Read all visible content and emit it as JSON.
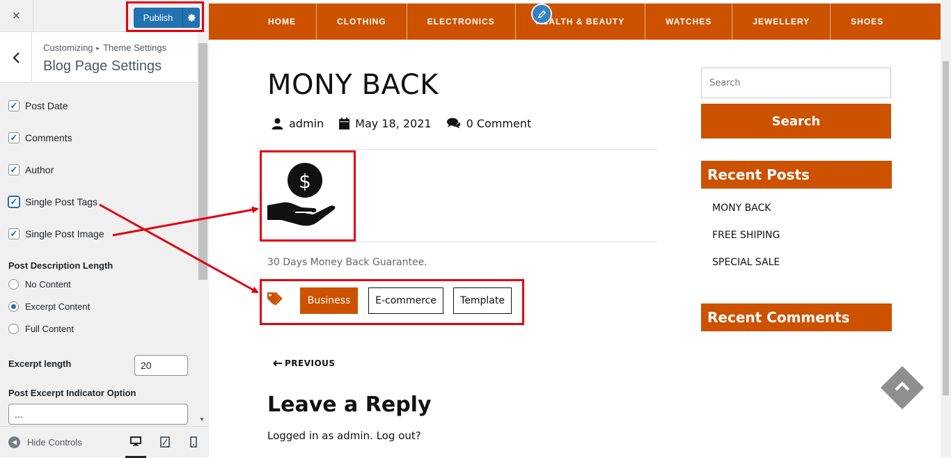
{
  "customizer": {
    "close_icon": "×",
    "publish_label": "Publish",
    "publish_settings_icon": "gear-icon",
    "breadcrumb_root": "Customizing",
    "breadcrumb_separator": "▸",
    "breadcrumb_section": "Theme Settings",
    "section_title": "Blog Page Settings",
    "checkboxes": [
      {
        "label": "Post Date",
        "checked": true
      },
      {
        "label": "Comments",
        "checked": true
      },
      {
        "label": "Author",
        "checked": true
      },
      {
        "label": "Single Post Tags",
        "checked": true
      },
      {
        "label": "Single Post Image",
        "checked": true
      }
    ],
    "post_description_length": {
      "label": "Post Description Length",
      "options": [
        "No Content",
        "Excerpt Content",
        "Full Content"
      ],
      "selected": "Excerpt Content"
    },
    "excerpt_length": {
      "label": "Excerpt length",
      "value": "20"
    },
    "excerpt_indicator": {
      "label": "Post Excerpt Indicator Option",
      "value": "..."
    },
    "footer": {
      "hide_controls_label": "Hide Controls",
      "devices": [
        "desktop",
        "tablet",
        "mobile"
      ],
      "active_device": "desktop"
    }
  },
  "site": {
    "nav_items": [
      "HOME",
      "CLOTHING",
      "ELECTRONICS",
      "HEALTH & BEAUTY",
      "WATCHES",
      "JEWELLERY",
      "SHOES"
    ],
    "post": {
      "title": "MONY BACK",
      "author": "admin",
      "date": "May 18, 2021",
      "comments": "0 Comment",
      "excerpt": "30 Days Money Back Guarantee.",
      "tags": [
        "Business",
        "E-commerce",
        "Template"
      ],
      "active_tag": "Business",
      "previous_label": "PREVIOUS"
    },
    "reply": {
      "title": "Leave a Reply",
      "logged_in_text": "Logged in as admin. Log out?"
    },
    "sidebar": {
      "search_placeholder": "Search",
      "search_button": "Search",
      "recent_posts_title": "Recent Posts",
      "recent_posts": [
        "MONY BACK",
        "FREE SHIPING",
        "SPECIAL SALE"
      ],
      "recent_comments_title": "Recent Comments"
    }
  },
  "colors": {
    "accent": "#cc5200",
    "wp_blue": "#2271b1",
    "annotation_red": "#e1000f"
  }
}
